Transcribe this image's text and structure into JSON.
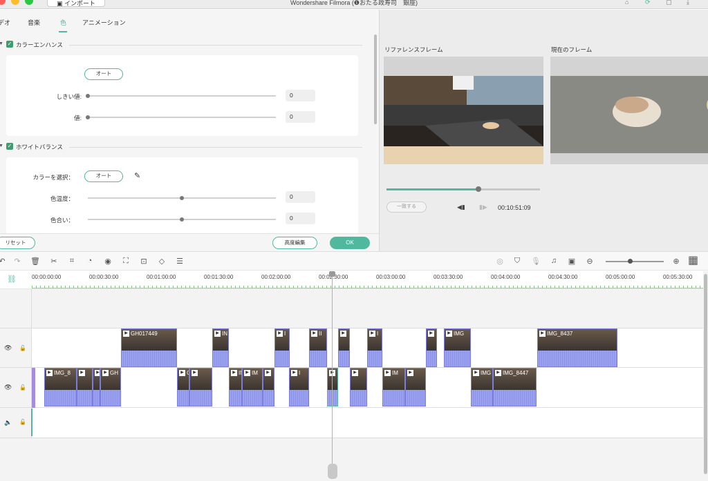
{
  "window": {
    "title": "Wondershare Filmora (❶おたる政寿司　銀座)",
    "import_label": "インポート"
  },
  "tabs": [
    {
      "label": "デオ"
    },
    {
      "label": "音楽"
    },
    {
      "label": "色"
    },
    {
      "label": "アニメーション"
    }
  ],
  "color_enhance": {
    "title": "カラーエンハンス",
    "auto_label": "オート",
    "threshold": {
      "label": "しきい値:",
      "value": "0",
      "level": 0
    },
    "amount": {
      "label": "値:",
      "value": "0",
      "level": 0
    }
  },
  "white_balance": {
    "title": "ホワイトバランス",
    "select_color_label": "カラーを選択：",
    "auto_label": "オート",
    "temperature": {
      "label": "色温度：",
      "value": "0",
      "level": 0.5
    },
    "tint": {
      "label": "色合い：",
      "value": "0",
      "level": 0.5
    }
  },
  "buttons": {
    "reset": "リセット",
    "advanced": "高度編集",
    "ok": "OK"
  },
  "preview": {
    "reference_label": "リファレンスフレーム",
    "current_label": "現在のフレーム",
    "match_label": "一致する",
    "timecode": "00:10:51:09",
    "progress": 0.6
  },
  "ruler": {
    "ticks": [
      "00:00:00:00",
      "00:00:30:00",
      "00:01:00:00",
      "00:01:30:00",
      "00:02:00:00",
      "00:02:30:00",
      "00:03:00:00",
      "00:03:30:00",
      "00:04:00:00",
      "00:04:30:00",
      "00:05:00:00",
      "00:05:30:00"
    ]
  },
  "clips_upper": [
    {
      "label": "GH017449"
    },
    {
      "label": "IN"
    },
    {
      "label": "I"
    },
    {
      "label": "II"
    },
    {
      "label": ""
    },
    {
      "label": "I"
    },
    {
      "label": ""
    },
    {
      "label": "IMG"
    },
    {
      "label": "IMG_8437"
    }
  ],
  "clips_lower": [
    {
      "label": "IMG_8"
    },
    {
      "label": ""
    },
    {
      "label": "G"
    },
    {
      "label": "GH"
    },
    {
      "label": "GH"
    },
    {
      "label": ""
    },
    {
      "label": "IM"
    },
    {
      "label": "IM"
    },
    {
      "label": ""
    },
    {
      "label": "I"
    },
    {
      "label": ""
    },
    {
      "label": ""
    },
    {
      "label": "IM"
    },
    {
      "label": ""
    },
    {
      "label": "IMG"
    },
    {
      "label": "IMG_8447"
    }
  ],
  "colors": {
    "accent": "#50b89f",
    "clip": "#aab0ef",
    "clip_border": "#7b7be0"
  }
}
